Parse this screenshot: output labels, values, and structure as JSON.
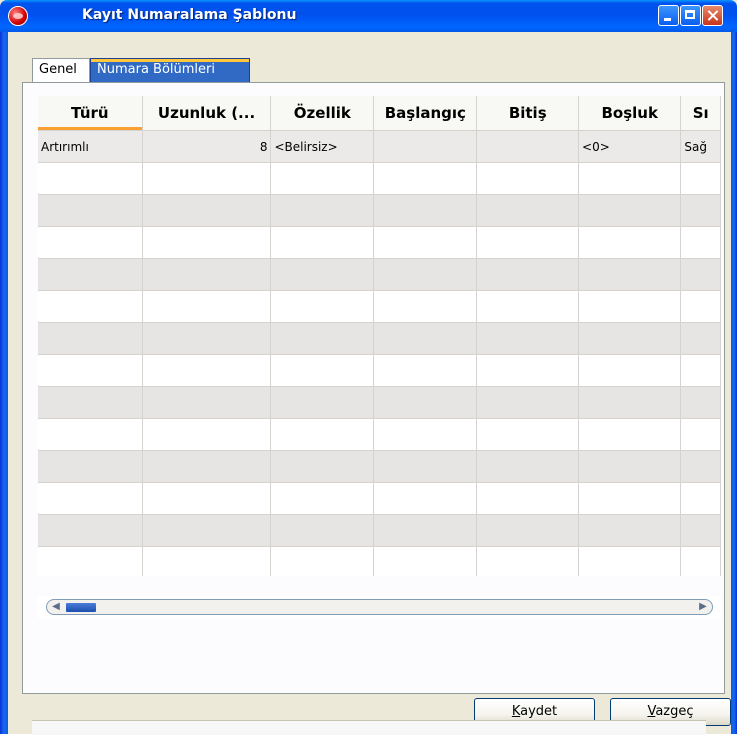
{
  "window": {
    "title": "Kayıt Numaralama Şablonu",
    "controls": {
      "minimize_icon": "minimize-icon",
      "maximize_icon": "maximize-icon",
      "close_icon": "close-icon"
    }
  },
  "tabs": [
    {
      "label": "Genel",
      "active": false
    },
    {
      "label": "Numara Bölümleri",
      "active": true
    }
  ],
  "grid": {
    "columns": [
      "Türü",
      "Uzunluk (...",
      "Özellik",
      "Başlangıç",
      "Bitiş",
      "Boşluk",
      "Sı"
    ],
    "rows": [
      [
        "Artırımlı",
        "8",
        "<Belirsiz>",
        "",
        "",
        "<0>",
        "Sağ"
      ]
    ],
    "empty_rows": 13
  },
  "scrollbar": {
    "left_arrow": "left-arrow-icon",
    "right_arrow": "right-arrow-icon",
    "position": 0.0
  },
  "buttons": {
    "kaydet": {
      "first": "K",
      "rest": "aydet"
    },
    "vazgec": {
      "first": "V",
      "rest": "azgeç"
    }
  },
  "colors": {
    "titlebar": "#0053EE",
    "active_tab": "#316AC5",
    "sort_indicator": "#F9A030",
    "alt_row": "#E6E5E4"
  }
}
